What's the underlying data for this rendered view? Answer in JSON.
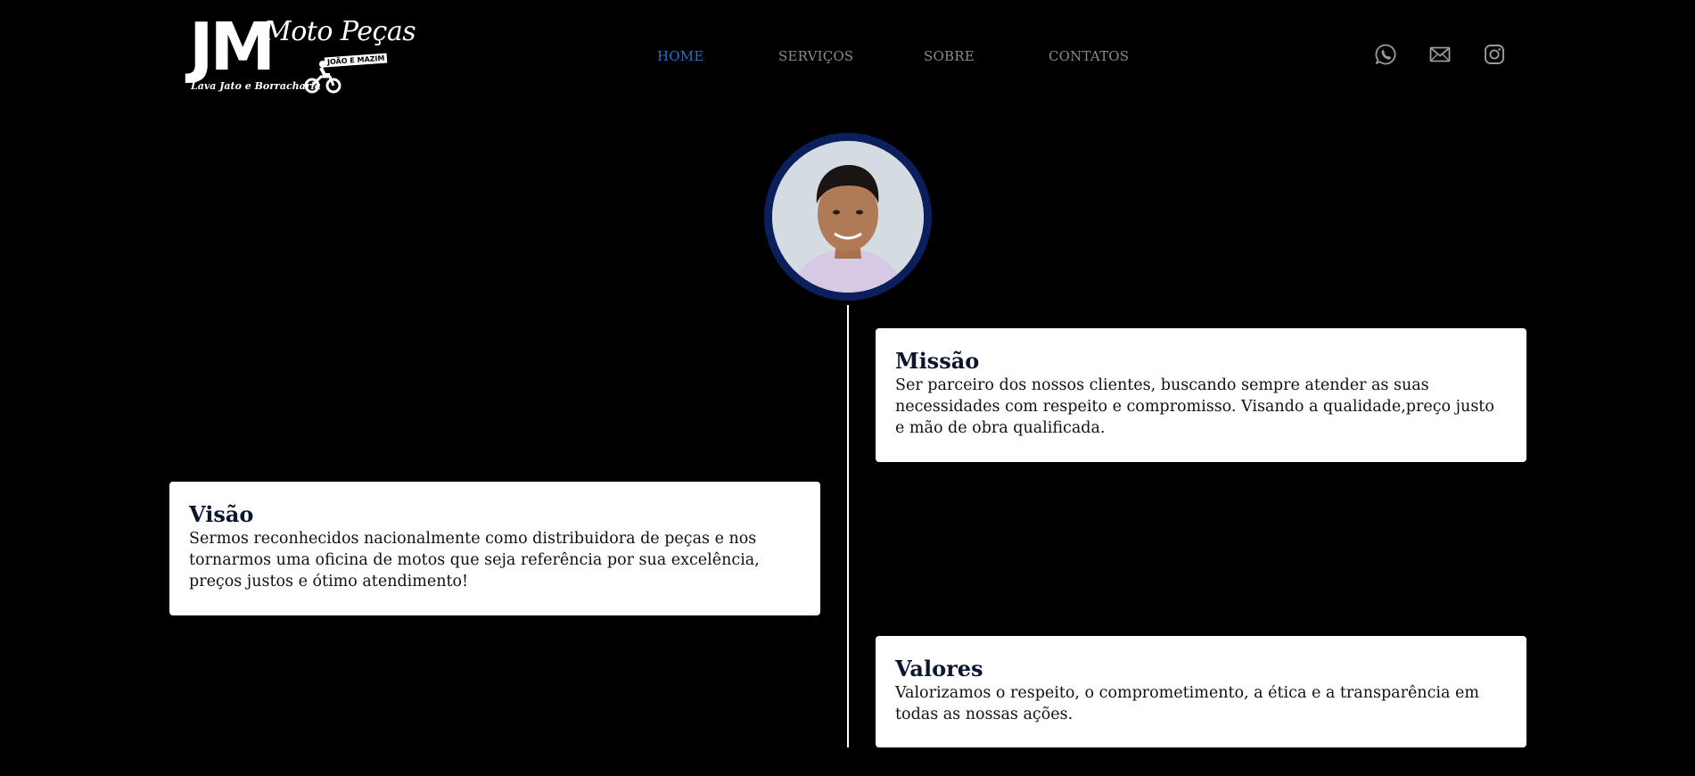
{
  "logo": {
    "mark": "JM",
    "name": "Moto Peças",
    "subtitle": "JOÃO E MAZIM",
    "tagline": "Lava Jato e Borracharia"
  },
  "nav": {
    "items": [
      {
        "label": "HOME",
        "active": true
      },
      {
        "label": "SERVIÇOS",
        "active": false
      },
      {
        "label": "SOBRE",
        "active": false
      },
      {
        "label": "CONTATOS",
        "active": false
      }
    ],
    "active_color": "#1f6fd6",
    "inactive_color": "#8a8a8a"
  },
  "social": [
    {
      "icon": "whatsapp-icon"
    },
    {
      "icon": "mail-icon"
    },
    {
      "icon": "instagram-icon"
    }
  ],
  "profile": {
    "ring_color": "#0b1f5c"
  },
  "cards": {
    "missao": {
      "title": "Missão",
      "text": "Ser parceiro dos nossos clientes, buscando sempre atender as suas necessidades com respeito e compromisso. Visando a qualidade,preço justo e mão de obra qualificada."
    },
    "visao": {
      "title": "Visão",
      "text": "Sermos reconhecidos nacionalmente como distribuidora de peças e nos tornarmos uma oficina de motos que seja referência por sua excelência, preços justos e ótimo atendimento!"
    },
    "valores": {
      "title": "Valores",
      "text": "Valorizamos o respeito, o comprometimento, a ética e a transparência em todas as nossas ações."
    }
  }
}
